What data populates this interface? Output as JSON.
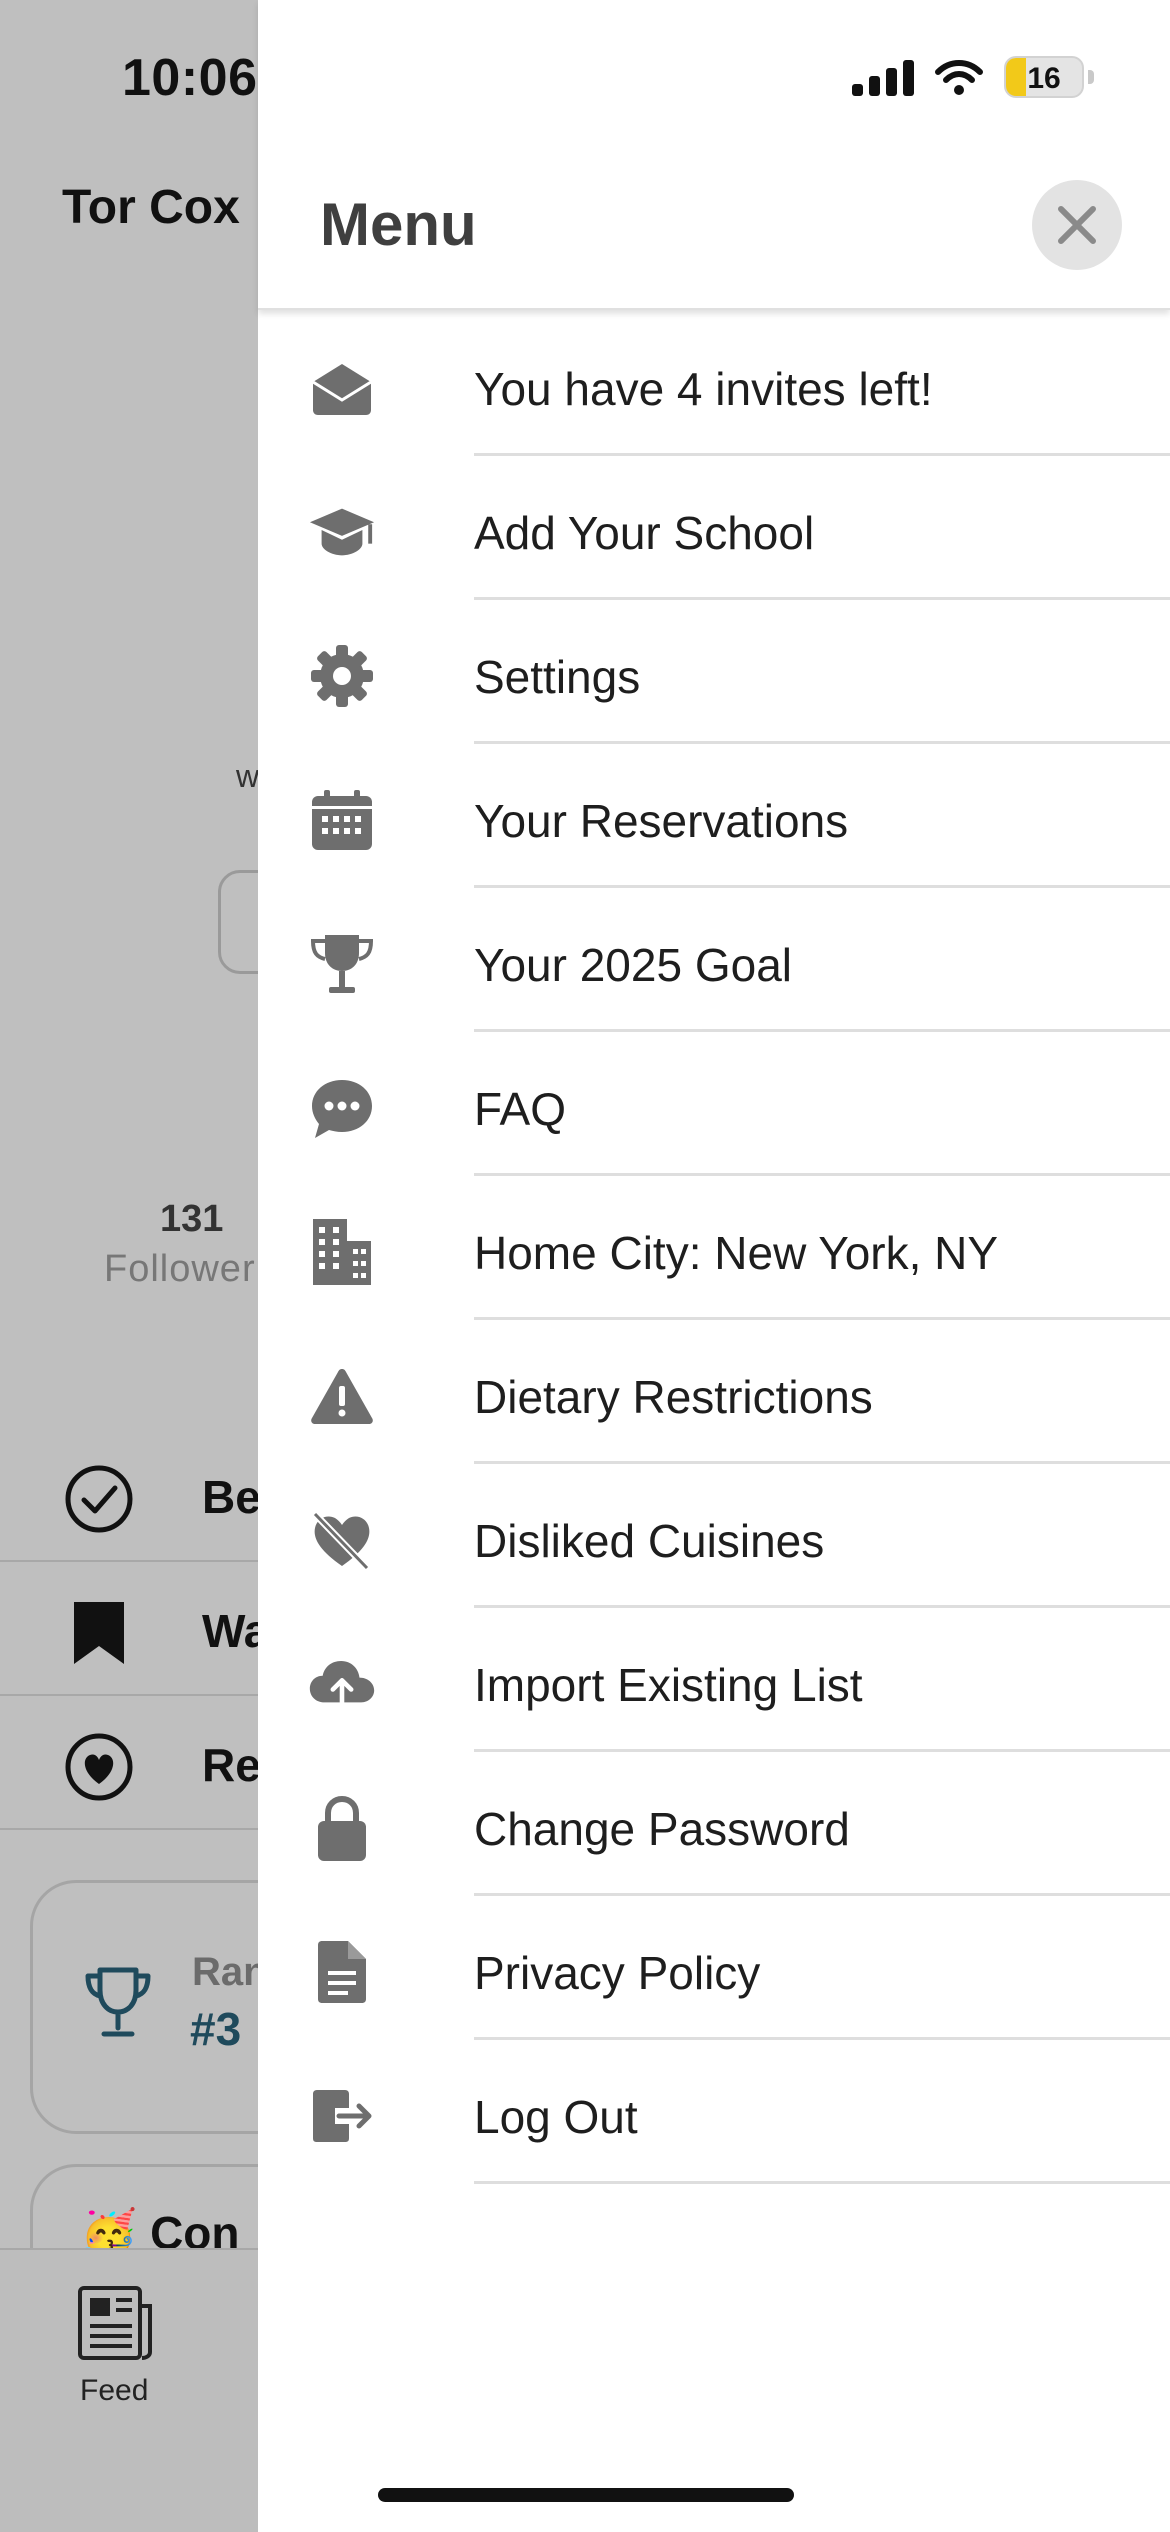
{
  "status_bar": {
    "time": "10:06",
    "battery": "16"
  },
  "background": {
    "profile_name": "Tor Cox",
    "partial_text": "w",
    "followers_count": "131",
    "followers_label": "Follower",
    "rows": [
      "Be",
      "Wa",
      "Re"
    ],
    "rank_label": "Ran",
    "rank_value": "#3",
    "congrats_text": "Con",
    "tab_feed": "Feed"
  },
  "menu": {
    "title": "Menu",
    "items": [
      {
        "label": "You have 4 invites left!",
        "icon": "envelope-open-icon"
      },
      {
        "label": "Add Your School",
        "icon": "graduation-cap-icon"
      },
      {
        "label": "Settings",
        "icon": "gear-icon"
      },
      {
        "label": "Your Reservations",
        "icon": "calendar-icon"
      },
      {
        "label": "Your 2025 Goal",
        "icon": "trophy-icon"
      },
      {
        "label": "FAQ",
        "icon": "chat-bubble-icon"
      },
      {
        "label": "Home City: New York, NY",
        "icon": "building-icon"
      },
      {
        "label": "Dietary Restrictions",
        "icon": "warning-icon"
      },
      {
        "label": "Disliked Cuisines",
        "icon": "heart-slash-icon"
      },
      {
        "label": "Import Existing List",
        "icon": "cloud-upload-icon"
      },
      {
        "label": "Change Password",
        "icon": "lock-icon"
      },
      {
        "label": "Privacy Policy",
        "icon": "document-icon"
      },
      {
        "label": "Log Out",
        "icon": "logout-icon"
      }
    ]
  },
  "colors": {
    "icon_gray": "#6e6e6e",
    "rank_blue": "#1f4a5c",
    "battery_yellow": "#f2c919"
  }
}
